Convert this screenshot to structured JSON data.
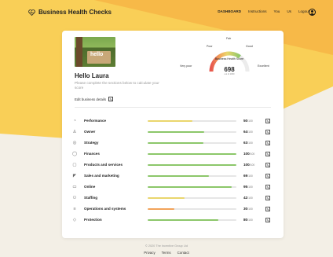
{
  "colors": {
    "accent_yellow": "#f9cf57",
    "accent_orange": "#f0a94a",
    "bar_green": "#8cc76a",
    "bar_yellow": "#ead66d",
    "bar_orange": "#f2a35a",
    "bg_cream": "#f3efe6"
  },
  "nav": {
    "brand": "Business Health Checks",
    "brand_icon": "heart-pulse-icon",
    "links": [
      "DASHBOARD",
      "Instructions",
      "You",
      "Us",
      "Logout"
    ],
    "avatar_icon": "user-circle-icon"
  },
  "profile": {
    "photo_text": "hello",
    "greeting": "Hello Laura",
    "intro": "Please complete the sections below to calculate your score",
    "edit_label": "Edit business details"
  },
  "gauge": {
    "labels": {
      "very_poor": "Very poor",
      "poor": "Poor",
      "fair": "Fair",
      "good": "Good",
      "excellent": "Excellent"
    },
    "title": "Business Health Score",
    "score": "698",
    "max": "out of 1000",
    "score_value": 698,
    "max_value": 1000
  },
  "sections": [
    {
      "name": "Performance",
      "icon": "gauge-icon",
      "score": "50",
      "max": "/100",
      "value": 0.5,
      "color": "#ead66d"
    },
    {
      "name": "Owner",
      "icon": "person-icon",
      "score": "64",
      "max": "/100",
      "value": 0.64,
      "color": "#8cc76a"
    },
    {
      "name": "Strategy",
      "icon": "target-icon",
      "score": "63",
      "max": "/100",
      "value": 0.63,
      "color": "#8cc76a"
    },
    {
      "name": "Finances",
      "icon": "coin-icon",
      "score": "100",
      "max": "/100",
      "value": 1.0,
      "color": "#8cc76a"
    },
    {
      "name": "Products and services",
      "icon": "box-icon",
      "score": "100",
      "max": "/100",
      "value": 1.0,
      "color": "#8cc76a"
    },
    {
      "name": "Sales and marketing",
      "icon": "megaphone-icon",
      "score": "69",
      "max": "/100",
      "value": 0.69,
      "color": "#8cc76a"
    },
    {
      "name": "Online",
      "icon": "laptop-icon",
      "score": "95",
      "max": "/100",
      "value": 0.95,
      "color": "#8cc76a"
    },
    {
      "name": "Staffing",
      "icon": "people-icon",
      "score": "42",
      "max": "/100",
      "value": 0.42,
      "color": "#ead66d"
    },
    {
      "name": "Operations and systems",
      "icon": "sliders-icon",
      "score": "30",
      "max": "/100",
      "value": 0.3,
      "color": "#f2a35a"
    },
    {
      "name": "Protection",
      "icon": "shield-icon",
      "score": "80",
      "max": "/100",
      "value": 0.8,
      "color": "#8cc76a"
    }
  ],
  "footer": {
    "copyright": "© 2020 The Incentive Group Ltd",
    "links": [
      "Privacy",
      "Terms",
      "Contact"
    ]
  }
}
